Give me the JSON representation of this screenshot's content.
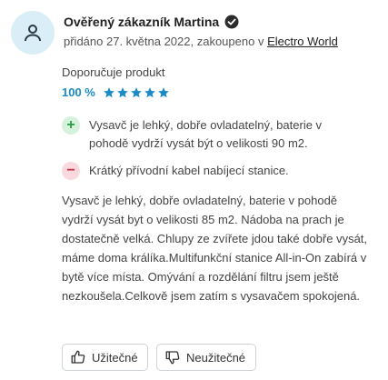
{
  "review": {
    "author": "Ověřený zákazník Martina",
    "meta_prefix": "přidáno 27. května 2022, zakoupeno v ",
    "store_link": "Electro World",
    "recommend": "Doporučuje produkt",
    "rating_percent": "100 %",
    "rating_stars": 5,
    "rating_max": 5,
    "pro": "Vysavč je lehký, dobře ovladatelný, baterie v pohodě vydrží vysát být o velikosti 90 m2.",
    "con": "Krátký přívodní kabel nabíjecí stanice.",
    "body": "Vysavč je lehký, dobře ovladatelný, baterie v pohodě vydrží vysát byt o velikosti 85 m2. Nádoba na prach je dostatečně velká. Chlupy ze zvířete jdou také dobře vysát, máme doma králíka.Multifunkční stanice All-in-On zabírá v bytě více místa. Omývání a rozdělání filtru jsem ještě nezkoušela.Celkově jsem zatím s vysavačem spokojená."
  },
  "buttons": {
    "like_label": "Užitečné",
    "dislike_label": "Neužitečné"
  },
  "colors": {
    "accent": "#1a8bc4",
    "pro": "#2d9a46",
    "con": "#c73245"
  }
}
